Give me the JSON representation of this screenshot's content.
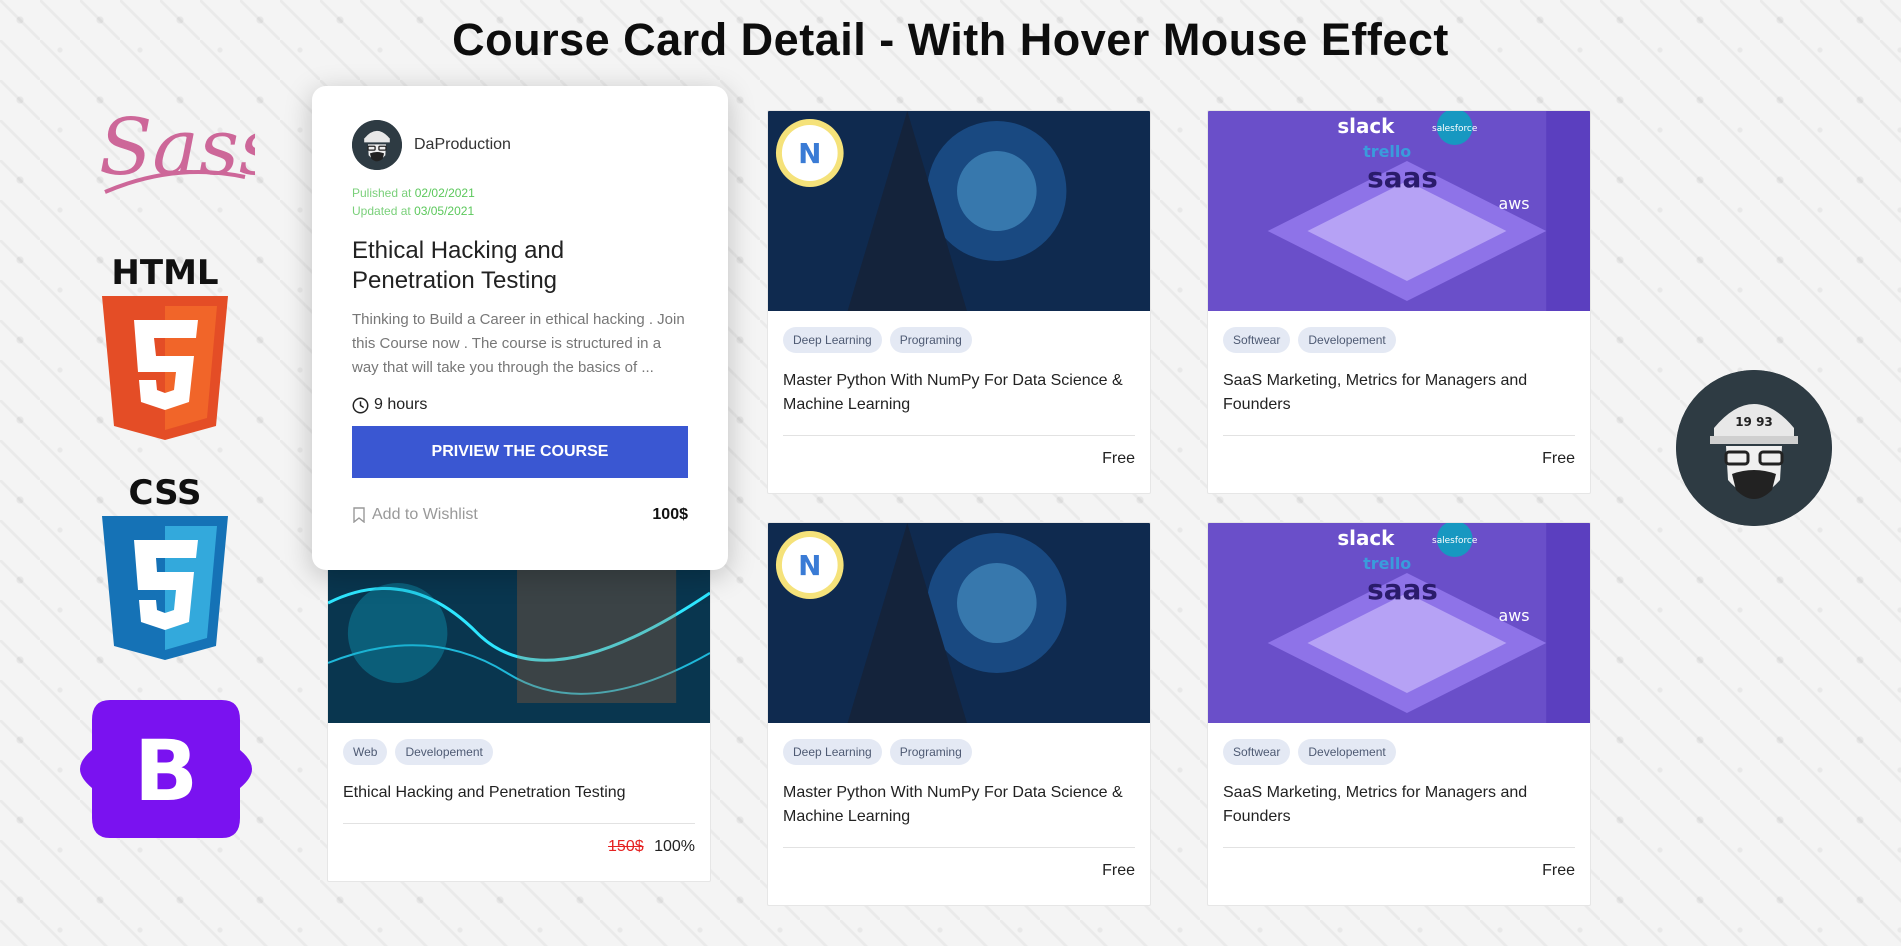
{
  "page_title": "Course Card Detail - With Hover Mouse Effect",
  "left_logos": [
    {
      "name": "sass-logo",
      "text": "Sass"
    },
    {
      "name": "html-logo",
      "text": "HTML"
    },
    {
      "name": "css-logo",
      "text": "CSS"
    },
    {
      "name": "bootstrap-logo",
      "text": "B"
    }
  ],
  "hover_card": {
    "author": "DaProduction",
    "published_label": "Pulished at",
    "published_date": "02/02/2021",
    "updated_label": "Updated at",
    "updated_date": "03/05/2021",
    "title": "Ethical Hacking and Penetration Testing",
    "description": "Thinking to Build a Career in ethical hacking . Join this Course now . The course is structured in a way that will take you through the basics of ...",
    "duration": "9 hours",
    "button_label": "PRIVIEW THE COURSE",
    "wishlist_label": "Add to Wishlist",
    "price": "100$"
  },
  "cards": [
    {
      "tags": [
        "Deep Learning",
        "Programing"
      ],
      "title": "Master Python With NumPy For Data Science & Machine Learning",
      "price": "Free"
    },
    {
      "tags": [
        "Softwear",
        "Developement"
      ],
      "title": "SaaS Marketing, Metrics for Managers and Founders",
      "price": "Free"
    },
    {
      "tags": [
        "Web",
        "Developement"
      ],
      "title": "Ethical Hacking and Penetration Testing",
      "old_price": "150$",
      "price": "100%"
    },
    {
      "tags": [
        "Deep Learning",
        "Programing"
      ],
      "title": "Master Python With NumPy For Data Science & Machine Learning",
      "price": "Free"
    },
    {
      "tags": [
        "Softwear",
        "Developement"
      ],
      "title": "SaaS Marketing, Metrics for Managers and Founders",
      "price": "Free"
    }
  ],
  "thumb_text": {
    "slack": "slack",
    "salesforce": "salesforce",
    "trello": "trello",
    "saas": "saas",
    "aws": "aws"
  },
  "avatar_badge": "19 93",
  "colors": {
    "accent": "#3a57d2",
    "date_green": "#5cc85c",
    "old_price_red": "#e52222"
  }
}
